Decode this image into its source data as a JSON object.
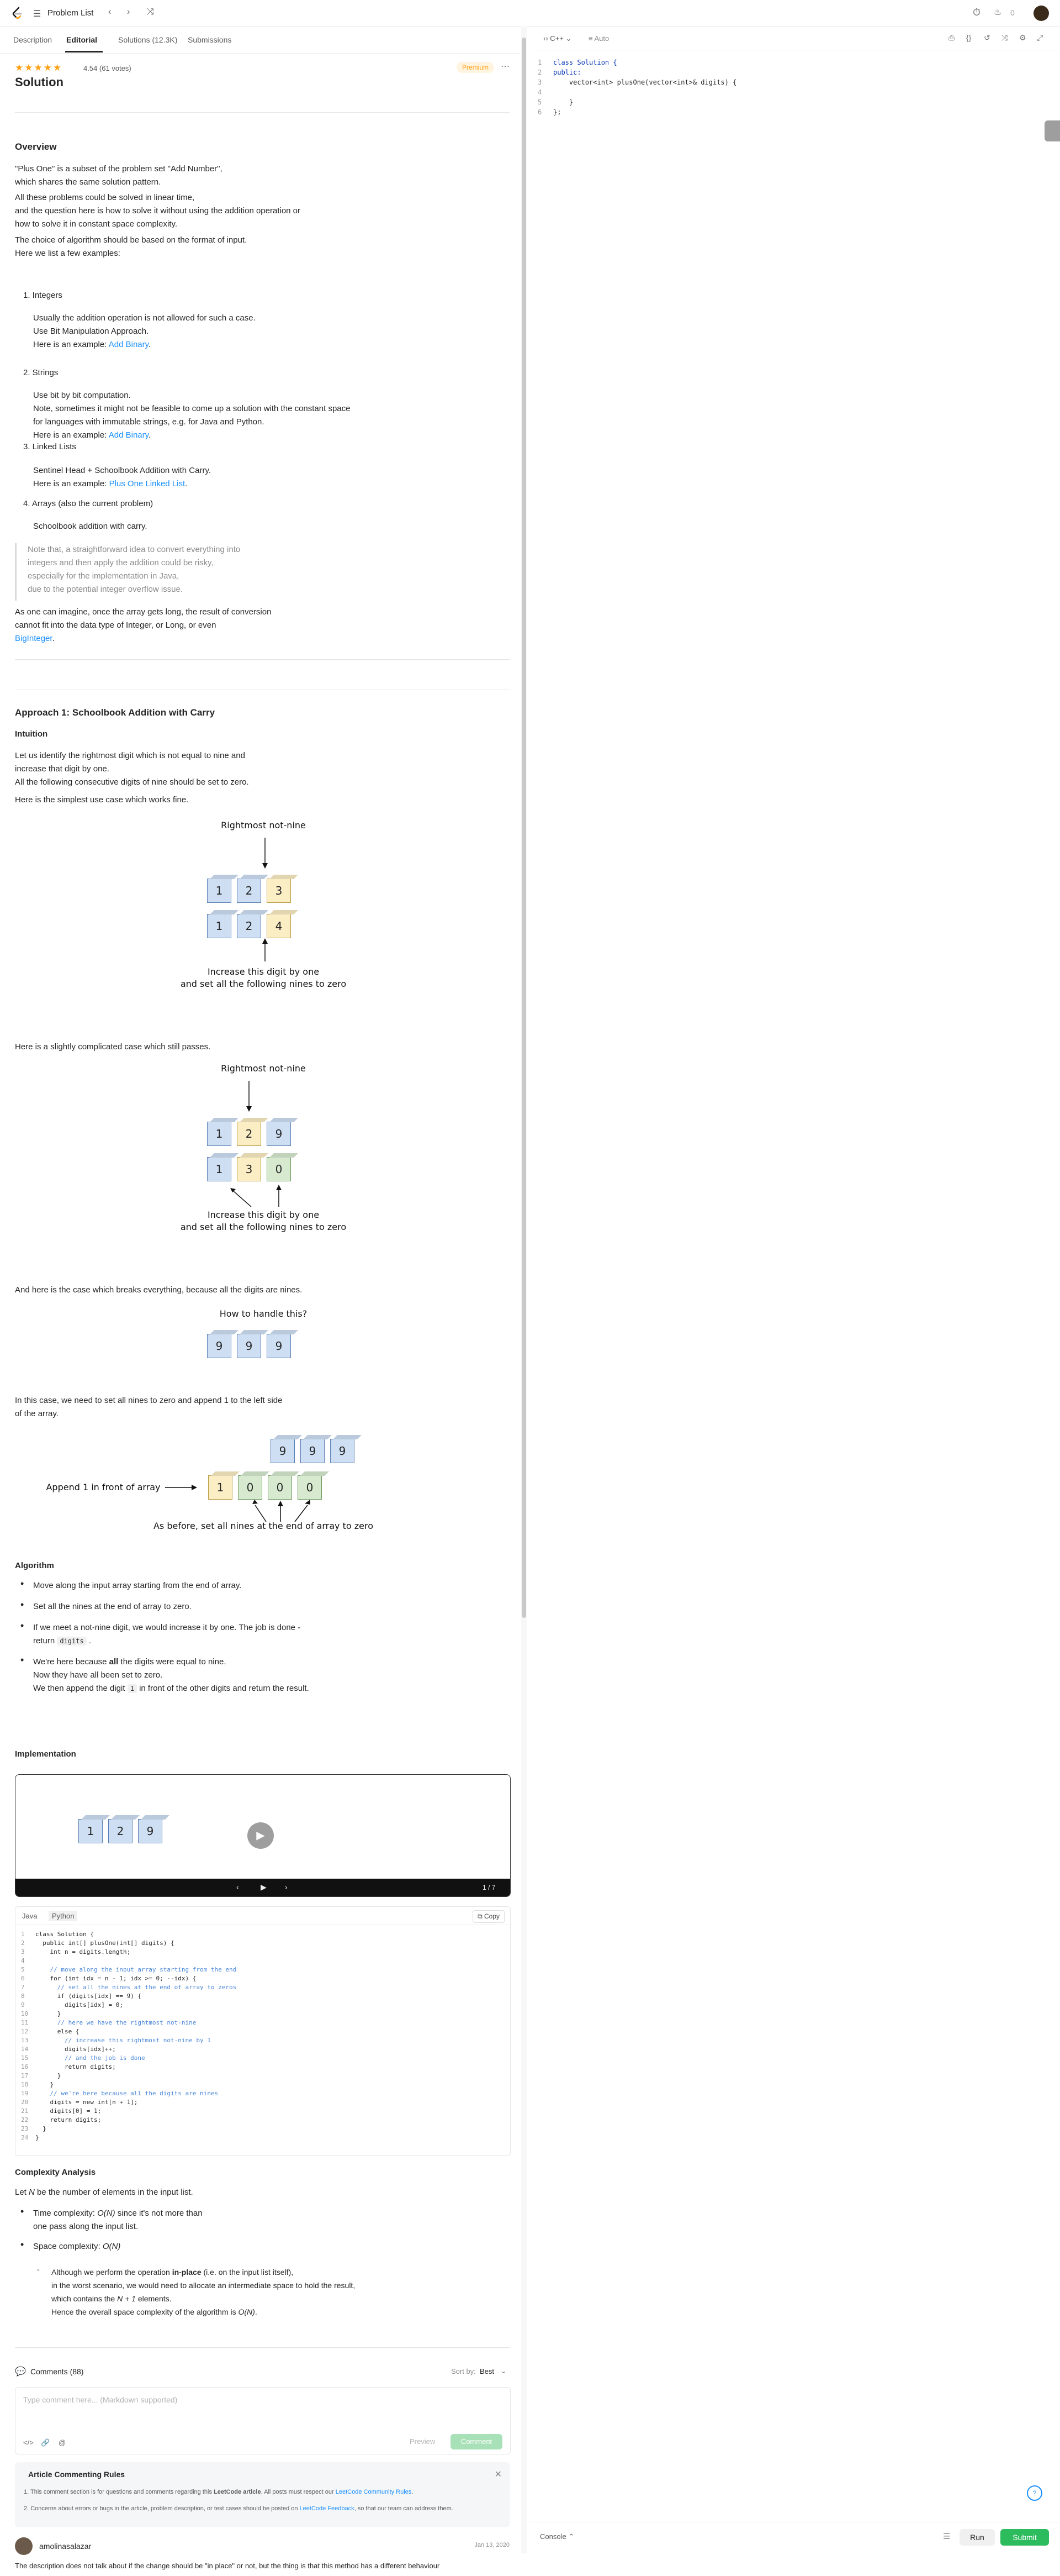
{
  "topbar": {
    "problem_list": "Problem List"
  },
  "tabs": [
    {
      "label": "Description"
    },
    {
      "label": "Editorial"
    },
    {
      "label": "Solutions (12.3K)"
    },
    {
      "label": "Submissions"
    }
  ],
  "article": {
    "rating_text": "4.54 (61 votes)",
    "stars_value": 4.54,
    "premium_label": "Premium",
    "title": "Solution",
    "overview_heading": "Overview",
    "overview_p1_l1": "\"Plus One\" is a subset of the problem set \"Add Number\",",
    "overview_p1_l2": "which shares the same solution pattern.",
    "overview_p2_l1": "All these problems could be solved in linear time,",
    "overview_p2_l2": "and the question here is how to solve it without using the addition operation or",
    "overview_p2_l3": "how to solve it in constant space complexity.",
    "overview_p3_l1": "The choice of algorithm should be based on the format of input.",
    "overview_p3_l2": "Here we list a few examples:",
    "item1_title": "1. Integers",
    "item1_l1": "Usually the addition operation is not allowed for such a case.",
    "item1_l2": "Use Bit Manipulation Approach.",
    "item1_l3_prefix": "Here is an example: ",
    "item1_link": "Add Binary",
    "item2_title": "2. Strings",
    "item2_l1": "Use bit by bit computation.",
    "item2_l2": "Note, sometimes it might not be feasible to come up a solution with the constant space",
    "item2_l3": "for languages with immutable strings, e.g. for Java and Python.",
    "item2_l4": "Here is an example: ",
    "item2_link": "Add Binary",
    "item3_title": "3. Linked Lists",
    "item3_l1": "Sentinel Head + Schoolbook Addition with Carry.",
    "item3_l2": "Here is an example: ",
    "item3_link": "Plus One Linked List",
    "item4_title": "4. Arrays (also the current problem)",
    "item4_l1": "Schoolbook addition with carry.",
    "quote_l1": "Note that, a straightforward idea to convert everything into",
    "quote_l2": "integers and then apply the addition could be risky,",
    "quote_l3": "especially for the implementation in Java,",
    "quote_l4": "due to the potential integer overflow issue.",
    "conv_l1": "As one can imagine, once the array gets long, the result of conversion",
    "conv_l2": "cannot fit into the data type of Integer, or Long, or even",
    "conv_link": "BigInteger",
    "approach_heading": "Approach 1: Schoolbook Addition with Carry",
    "intuition_heading": "Intuition",
    "intuition_l1": "Let us identify the rightmost digit which is not equal to nine and",
    "intuition_l2": "increase that digit by one.",
    "intuition_l3": "All the following consecutive digits of nine should be set to zero.",
    "simplest_case": "Here is the simplest use case which works fine.",
    "complicated_case": "Here is a slightly complicated case which still passes.",
    "breaks_case": "And here is the case which breaks everything, because all the digits are nines.",
    "nines_l1": "In this case, we need to set all nines to zero and append 1 to the left side",
    "nines_l2": "of the array.",
    "algorithm_heading": "Algorithm",
    "alg_b1": "Move along the input array starting from the end of array.",
    "alg_b2": "Set all the nines at the end of array to zero.",
    "alg_b3_l1": "If we meet a not-nine digit, we would increase it by one. The job is done -",
    "alg_b3_l2": "return",
    "alg_b3_code": "digits",
    "alg_b4_l1_a": "We're here because ",
    "alg_b4_l1_b": "all",
    "alg_b4_l1_c": " the digits were equal to nine.",
    "alg_b4_l2": "Now they have all been set to zero.",
    "alg_b4_l3_a": "We then append the digit ",
    "alg_b4_l3_code": "1",
    "alg_b4_l3_b": " in front of the other digits and return the result.",
    "implementation_heading": "Implementation",
    "player_counter": "1 / 7",
    "complexity_heading": "Complexity Analysis",
    "cx_intro_a": "Let ",
    "cx_intro_var": "N",
    "cx_intro_b": " be the number of elements in the input list.",
    "cx_time_a": "Time complexity: ",
    "cx_time_val": "O(N)",
    "cx_time_b": " since it's not more than",
    "cx_time_l2": "one pass along the input list.",
    "cx_space_a": "Space complexity: ",
    "cx_space_val": "O(N)",
    "cx_sub_l1_a": "Although we perform the operation ",
    "cx_sub_l1_b": "in-place",
    "cx_sub_l1_c": " (i.e. on the input list itself),",
    "cx_sub_l2": "in the worst scenario, we would need to allocate an intermediate space to hold the result,",
    "cx_sub_l3_a": "which contains the ",
    "cx_sub_l3_var": "N + 1",
    "cx_sub_l3_b": " elements.",
    "cx_sub_l4_a": "Hence the overall space complexity of the algorithm is ",
    "cx_sub_l4_var": "O(N)",
    "cx_sub_l4_b": "."
  },
  "diagrams": {
    "d1_top_label": "Rightmost not-nine",
    "d1_row1": [
      "1",
      "2",
      "3"
    ],
    "d1_row2": [
      "1",
      "2",
      "4"
    ],
    "d1_bottom_l1": "Increase this digit by one",
    "d1_bottom_l2": "and set all the following nines to zero",
    "d2_top_label": "Rightmost not-nine",
    "d2_row1": [
      "1",
      "2",
      "9"
    ],
    "d2_row2": [
      "1",
      "3",
      "0"
    ],
    "d2_bottom_l1": "Increase this digit by one",
    "d2_bottom_l2": "and set all the following nines to zero",
    "d3_label": "How to handle this?",
    "d3_row": [
      "9",
      "9",
      "9"
    ],
    "d4_top_row": [
      "9",
      "9",
      "9"
    ],
    "d4_left_label": "Append 1 in front of array",
    "d4_row": [
      "1",
      "0",
      "0",
      "0"
    ],
    "d4_bottom": "As before, set all nines at the end of array to zero",
    "player_row": [
      "1",
      "2",
      "9"
    ]
  },
  "code": {
    "tabs": [
      "Java",
      "Python"
    ],
    "copy_label": "Copy",
    "lines": [
      "class Solution {",
      "  public int[] plusOne(int[] digits) {",
      "    int n = digits.length;",
      "",
      "    // move along the input array starting from the end",
      "    for (int idx = n - 1; idx >= 0; --idx) {",
      "      // set all the nines at the end of array to zeros",
      "      if (digits[idx] == 9) {",
      "        digits[idx] = 0;",
      "      }",
      "      // here we have the rightmost not-nine",
      "      else {",
      "        // increase this rightmost not-nine by 1",
      "        digits[idx]++;",
      "        // and the job is done",
      "        return digits;",
      "      }",
      "    }",
      "    // we're here because all the digits are nines",
      "    digits = new int[n + 1];",
      "    digits[0] = 1;",
      "    return digits;",
      "  }",
      "}"
    ]
  },
  "comments": {
    "heading": "Comments (88)",
    "sort_label": "Sort by:",
    "sort_value": "Best",
    "placeholder": "Type comment here... (Markdown supported)",
    "preview_label": "Preview",
    "comment_label": "Comment",
    "rules_title": "Article Commenting Rules",
    "rules_l1_a": "1. This comment section is for questions and comments regarding this ",
    "rules_l1_b": "LeetCode article",
    "rules_l1_c": ". All posts must respect our ",
    "rules_l1_link": "LeetCode Community Rules",
    "rules_l2_a": "2. Concerns about errors or bugs in the article, problem description, or test cases should be posted on ",
    "rules_l2_link": "LeetCode Feedback",
    "rules_l2_b": ", so that our team can address them.",
    "commenter_name": "amolinasalazar",
    "comment_date": "Jan 13, 2020",
    "comment_text": "The description does not talk about if the change should be \"in place\" or not, but the thing is that this method has a different behaviour"
  },
  "editor": {
    "language": "C++",
    "auto_label": "Auto",
    "lines": [
      "class Solution {",
      "public:",
      "    vector<int> plusOne(vector<int>& digits) {",
      "",
      "    }",
      "};"
    ],
    "console_label": "Console",
    "run_label": "Run",
    "submit_label": "Submit"
  },
  "colors": {
    "accent": "#ffa116",
    "link": "#1a90ff",
    "submit": "#2cbb5d"
  }
}
